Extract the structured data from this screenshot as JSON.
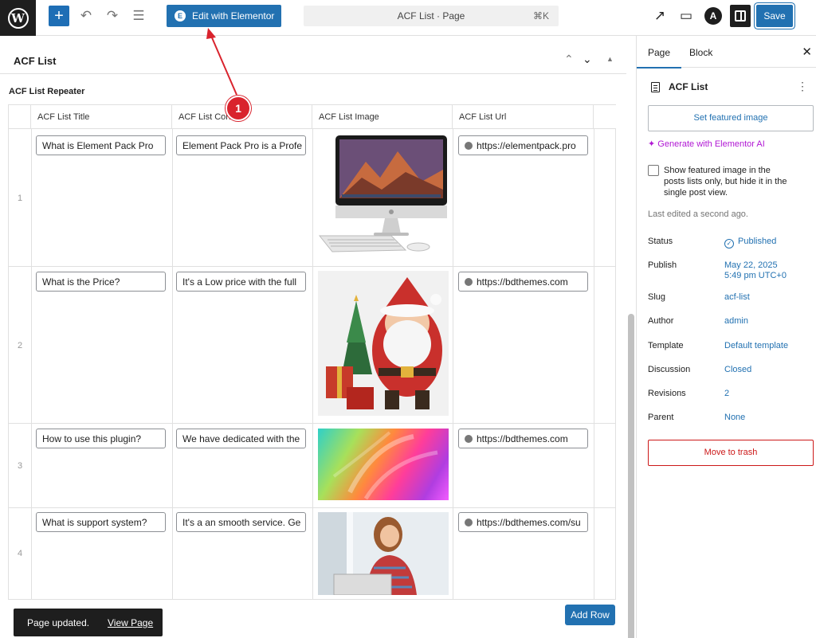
{
  "topbar": {
    "logo": "wordpress-logo",
    "add_icon": "+",
    "elementor_button": "Edit with Elementor",
    "document_title": "ACF List · Page",
    "shortcut": "⌘K",
    "save_label": "Save",
    "accent_color": "#2271b1"
  },
  "panel": {
    "title": "ACF List",
    "repeater_label": "ACF List Repeater",
    "columns": [
      "ACF List Title",
      "ACF List Content",
      "ACF List Image",
      "ACF List Url"
    ],
    "rows": [
      {
        "num": "1",
        "title": "What is Element Pack Pro",
        "content": "Element Pack Pro is a Profe",
        "image": "imac-computer",
        "url": "https://elementpack.pro"
      },
      {
        "num": "2",
        "title": "What is the Price?",
        "content": "It's a Low price with the full",
        "image": "santa-claus-figure",
        "url": "https://bdthemes.com"
      },
      {
        "num": "3",
        "title": "How to use this plugin?",
        "content": "We have dedicated with the",
        "image": "colorful-gradient",
        "url": "https://bdthemes.com"
      },
      {
        "num": "4",
        "title": "What is support system?",
        "content": "It's a an smooth service. Ge",
        "image": "woman-with-laptop",
        "url": "https://bdthemes.com/su"
      }
    ],
    "add_row_label": "Add Row"
  },
  "snackbar": {
    "message": "Page updated.",
    "link": "View Page"
  },
  "callout": {
    "number": "1"
  },
  "sidebar": {
    "tabs": [
      "Page",
      "Block"
    ],
    "doc_title": "ACF List",
    "featured_image": "Set featured image",
    "generate_ai": "Generate with Elementor AI",
    "checkbox_label": "Show featured image in the posts lists only, but hide it in the single post view.",
    "last_edited": "Last edited a second ago.",
    "meta": {
      "status_label": "Status",
      "status_value": "Published",
      "publish_label": "Publish",
      "publish_date": "May 22, 2025",
      "publish_time": "5:49 pm UTC+0",
      "slug_label": "Slug",
      "slug_value": "acf-list",
      "author_label": "Author",
      "author_value": "admin",
      "template_label": "Template",
      "template_value": "Default template",
      "discussion_label": "Discussion",
      "discussion_value": "Closed",
      "revisions_label": "Revisions",
      "revisions_value": "2",
      "parent_label": "Parent",
      "parent_value": "None"
    },
    "trash": "Move to trash"
  }
}
